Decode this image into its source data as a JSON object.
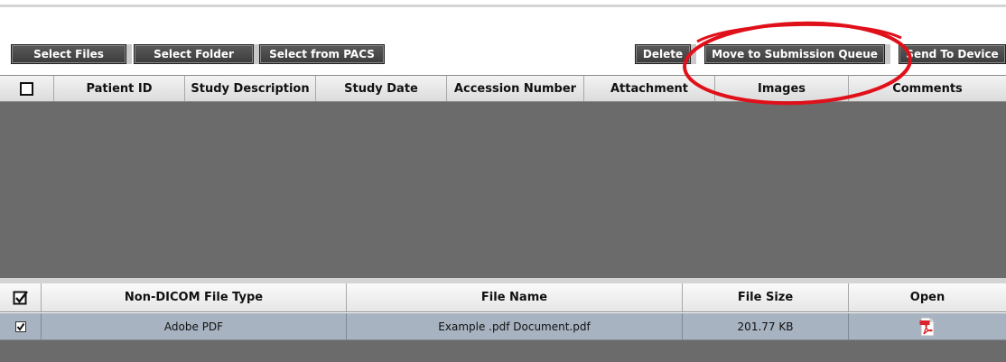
{
  "toolbar": {
    "select_files": "Select Files",
    "select_folder": "Select Folder",
    "select_from_pacs": "Select from PACS",
    "delete": "Delete",
    "move_to_submission_queue": "Move to Submission Queue",
    "send_to_device": "Send To Device"
  },
  "studies_grid": {
    "columns": [
      "Patient ID",
      "Study Description",
      "Study Date",
      "Accession Number",
      "Attachment",
      "Images",
      "Comments"
    ],
    "rows": []
  },
  "files_grid": {
    "columns": [
      "Non-DICOM File Type",
      "File Name",
      "File Size",
      "Open"
    ],
    "rows": [
      {
        "checked": true,
        "file_type": "Adobe PDF",
        "file_name": "Example .pdf Document.pdf",
        "file_size": "201.77 KB",
        "open_icon": "pdf-file-icon"
      }
    ]
  },
  "colors": {
    "button_bg": "#4a4a4a",
    "grid_body": "#6b6b6b",
    "selected_row": "#a7b3c1",
    "annotation_red": "#e0101a"
  }
}
